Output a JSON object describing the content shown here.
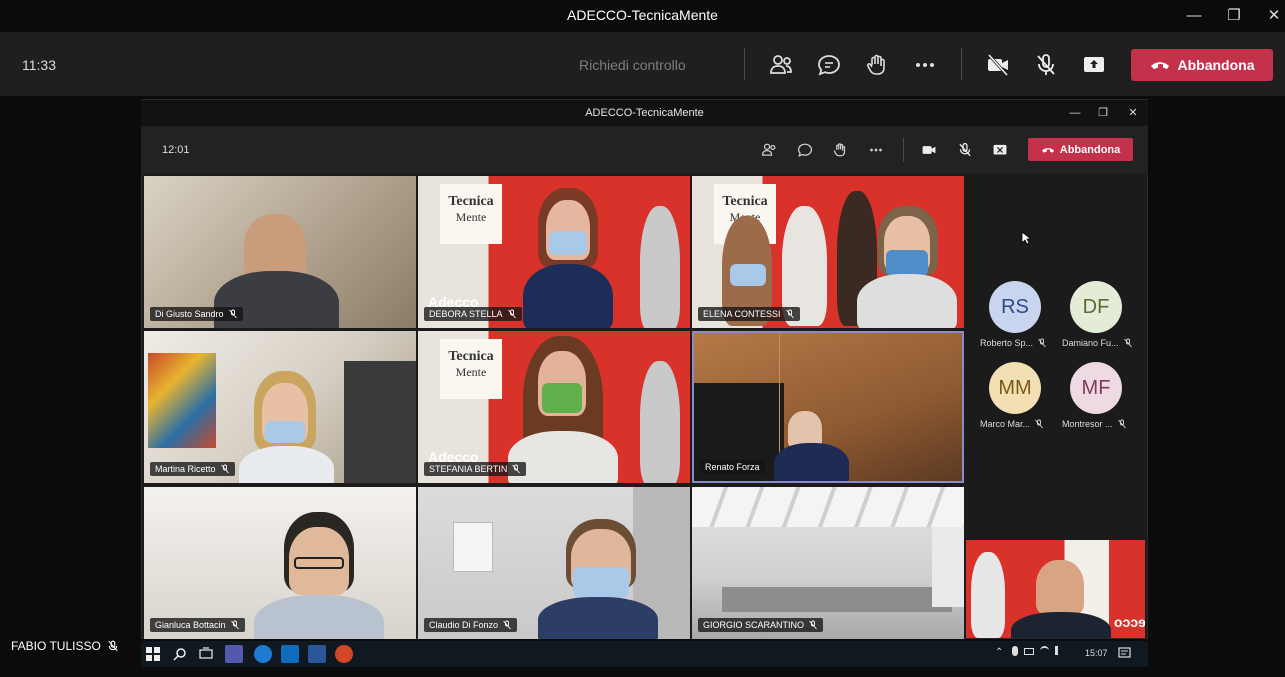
{
  "outer_window": {
    "title": "ADECCO-TecnicaMente",
    "time": "11:33",
    "request_control": "Richiedi controllo",
    "leave_label": "Abbandona",
    "controls": [
      "people-icon",
      "chat-icon",
      "raise-hand-icon",
      "more-icon",
      "camera-off-icon",
      "mic-off-icon",
      "share-icon"
    ]
  },
  "inner_window": {
    "title": "ADECCO-TecnicaMente",
    "time": "12:01",
    "leave_label": "Abbandona"
  },
  "tiles": [
    {
      "name": "Di Giusto Sandro"
    },
    {
      "name": "DEBORA STELLA",
      "brand": "Adecco"
    },
    {
      "name": "ELENA CONTESSI"
    },
    {
      "name": "Martina Ricetto"
    },
    {
      "name": "STEFANIA BERTIN",
      "brand": "Adecco"
    },
    {
      "name": "Renato Forza"
    },
    {
      "name": "Gianluca Bottacin"
    },
    {
      "name": "Claudio Di Fonzo"
    },
    {
      "name": "GIORGIO SCARANTINO"
    }
  ],
  "logo": {
    "line1": "Tecnica",
    "line2": "Mente"
  },
  "avatars": [
    {
      "initials": "RS",
      "name": "Roberto Sp...",
      "bg": "#c9d4ef",
      "fg": "#2b4a8a"
    },
    {
      "initials": "DF",
      "name": "Damiano Fu...",
      "bg": "#e3ecd6",
      "fg": "#5a6b34"
    },
    {
      "initials": "MM",
      "name": "Marco Mar...",
      "bg": "#f2dfb4",
      "fg": "#7a5a17"
    },
    {
      "initials": "MF",
      "name": "Montresor ...",
      "bg": "#efd9e3",
      "fg": "#7b3b5a"
    }
  ],
  "self_view": {
    "brand": "Adecco"
  },
  "taskbar": {
    "time": "15:07"
  },
  "local_user": {
    "name": "FABIO TULISSO"
  },
  "colors": {
    "leave": "#c4314b",
    "brand_red": "#d8322a"
  }
}
